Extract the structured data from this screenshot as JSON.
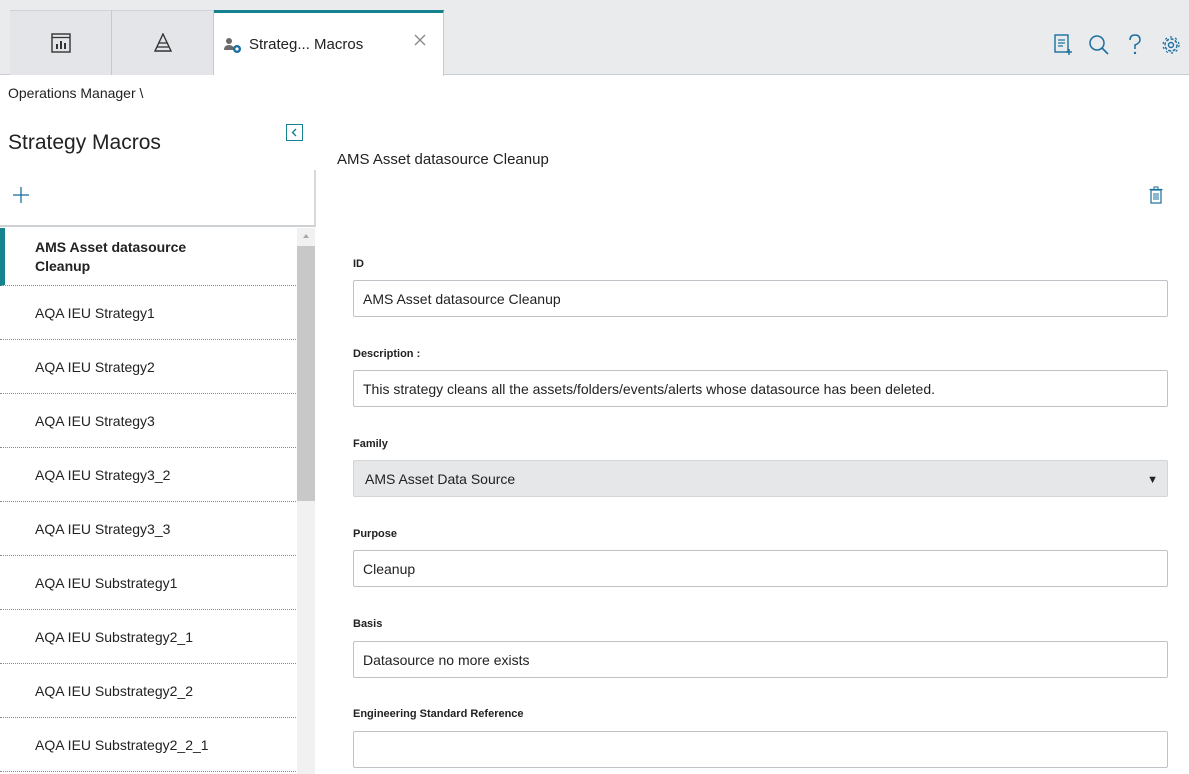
{
  "tabs": {
    "active_label": "Strateg... Macros"
  },
  "breadcrumb": "Operations Manager \\",
  "left_panel": {
    "title": "Strategy Macros",
    "items": [
      {
        "label": "AMS Asset datasource Cleanup",
        "selected": true
      },
      {
        "label": "AQA IEU Strategy1"
      },
      {
        "label": "AQA IEU Strategy2"
      },
      {
        "label": "AQA IEU Strategy3"
      },
      {
        "label": "AQA IEU Strategy3_2"
      },
      {
        "label": "AQA IEU Strategy3_3"
      },
      {
        "label": "AQA IEU Substrategy1"
      },
      {
        "label": "AQA IEU Substrategy2_1"
      },
      {
        "label": "AQA IEU Substrategy2_2"
      },
      {
        "label": "AQA IEU Substrategy2_2_1"
      }
    ]
  },
  "main": {
    "title": "AMS Asset datasource Cleanup",
    "fields": {
      "id": {
        "label": "ID",
        "value": "AMS Asset datasource Cleanup"
      },
      "description": {
        "label": "Description :",
        "value": "This strategy cleans all the assets/folders/events/alerts whose datasource has been deleted."
      },
      "family": {
        "label": "Family",
        "value": "AMS Asset Data Source"
      },
      "purpose": {
        "label": "Purpose",
        "value": "Cleanup"
      },
      "basis": {
        "label": "Basis",
        "value": "Datasource no more exists"
      },
      "engineering": {
        "label": "Engineering Standard Reference",
        "value": ""
      }
    }
  },
  "colors": {
    "accent": "#16818f",
    "icon": "#1b6f9e"
  }
}
